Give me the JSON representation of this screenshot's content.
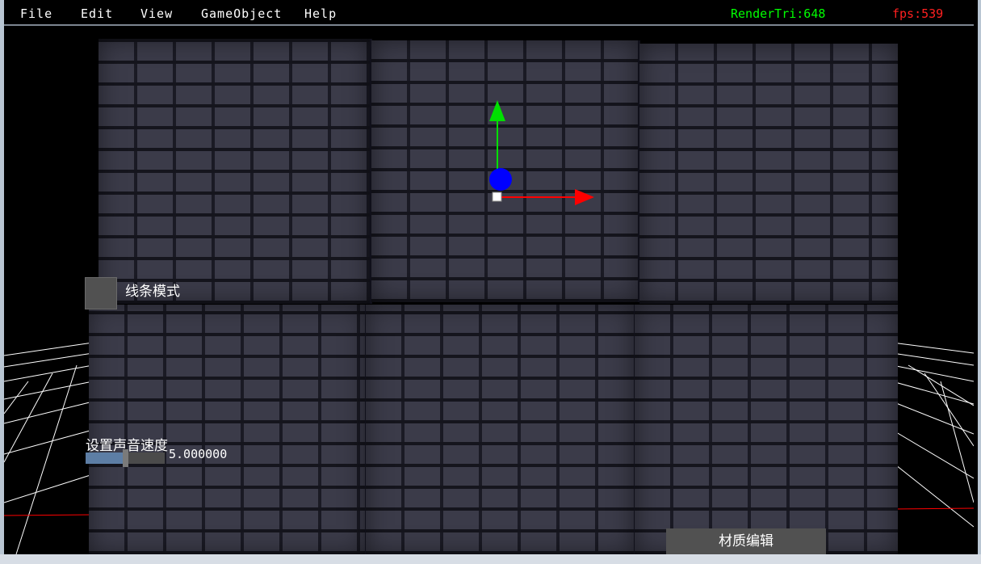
{
  "menu": {
    "file": "File",
    "edit": "Edit",
    "view": "View",
    "gameobject": "GameObject",
    "help": "Help"
  },
  "stats": {
    "render_tri": "RenderTri:648",
    "fps": "fps:539",
    "render_color": "#00ff00",
    "fps_color": "#ff2020"
  },
  "controls": {
    "wireframe_label": "线条模式",
    "sound_speed_label": "设置声音速度",
    "sound_speed_value": "5.000000",
    "sound_speed_fraction": 0.47,
    "material_edit_button": "材质编辑"
  },
  "gizmo": {
    "y_axis_color": "#00e000",
    "x_axis_color": "#ff0000",
    "center_color": "#0000ff"
  }
}
